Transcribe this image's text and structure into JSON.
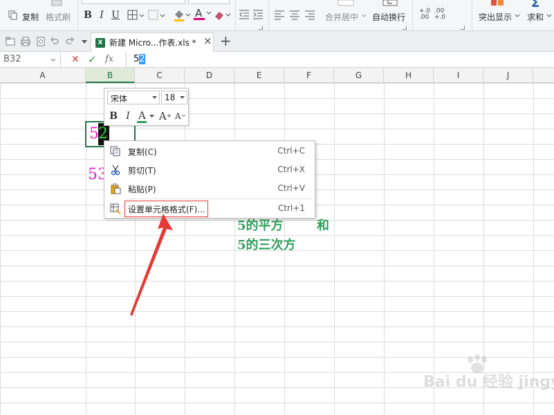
{
  "ribbon": {
    "copy": "复制",
    "format_painter": "格式刷",
    "bold": "B",
    "italic": "I",
    "underline": "U",
    "font_color_glyph": "A",
    "merge_center": "合并居中",
    "wrap_text": "自动换行",
    "decimal_inc_top": "+.0",
    "decimal_inc_bottom": ".00",
    "decimal_dec_top": ".00",
    "decimal_dec_bottom": "+.0",
    "highlight": "突出显示",
    "sum": "求和",
    "sum_glyph": "Σ",
    "colors": {
      "font_color_bar": "#e0007a",
      "fill_bar": "#f2c200"
    }
  },
  "tabs": {
    "doc_title": "新建 Micro...作表.xls *",
    "badge": "X",
    "close": "×",
    "add": "+"
  },
  "formula_bar": {
    "name_box": "B32",
    "cancel": "✕",
    "confirm": "✓",
    "fx": "fx",
    "content_plain": "5",
    "content_selected": "2"
  },
  "columns": [
    "A",
    "B",
    "C",
    "D",
    "E",
    "F",
    "G",
    "H",
    "I",
    "J"
  ],
  "cells": {
    "b_edit_prefix": "5",
    "b_edit_selected": "2",
    "b_below": "53",
    "note_line1": "5的平方",
    "note_line1_right": "和",
    "note_line2": "5的三次方"
  },
  "mini_toolbar": {
    "font": "宋体",
    "size": "18",
    "bold": "B",
    "italic": "I",
    "font_color": "A",
    "grow": "A",
    "grow_sign": "+",
    "shrink": "A",
    "shrink_sign": "−"
  },
  "context_menu": [
    {
      "label": "复制(C)",
      "shortcut": "Ctrl+C"
    },
    {
      "label": "剪切(T)",
      "shortcut": "Ctrl+X"
    },
    {
      "label": "粘贴(P)",
      "shortcut": "Ctrl+V"
    },
    {
      "label": "设置单元格格式(F)...",
      "shortcut": "Ctrl+1"
    }
  ],
  "colors": {
    "accent_green": "#217346",
    "cell_magenta": "#e020c8",
    "note_green": "#2e9e5a",
    "annotation_red": "#e53935",
    "selection_bg": "#111111",
    "selection_text": "#2bd63a"
  },
  "watermark": "Bai du 经验 jingyan.baidu.com"
}
